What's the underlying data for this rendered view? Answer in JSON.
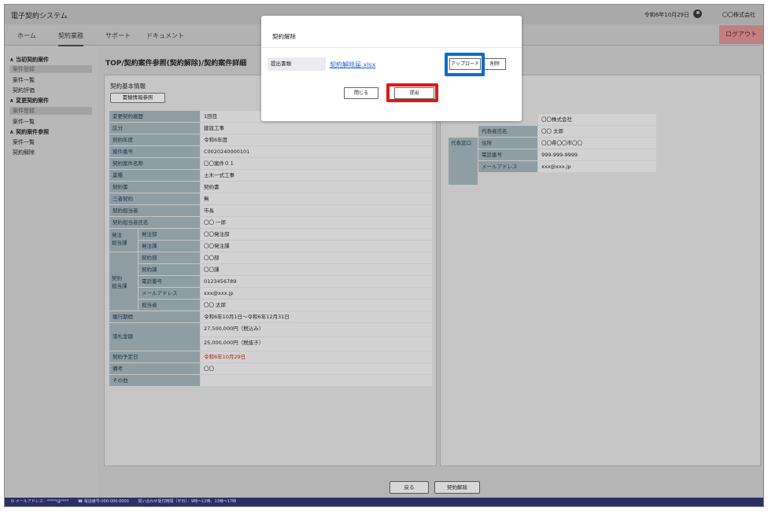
{
  "header": {
    "app_title": "電子契約システム",
    "datetime": "令和6年10月29日",
    "user_name": "〇〇株式会社"
  },
  "nav": {
    "tabs": [
      "ホーム",
      "契約業務",
      "サポート",
      "ドキュメント"
    ],
    "logout": "ログアウト"
  },
  "sidebar": {
    "items": [
      {
        "label": "∧ 当初契約案件",
        "type": "head"
      },
      {
        "label": "案件登録",
        "type": "active"
      },
      {
        "label": "案件一覧",
        "type": "item"
      },
      {
        "label": "契約評価",
        "type": "item"
      },
      {
        "label": "∧ 変更契約案件",
        "type": "head"
      },
      {
        "label": "案件登録",
        "type": "active"
      },
      {
        "label": "案件一覧",
        "type": "item"
      },
      {
        "label": "∧ 契約案件参照",
        "type": "head"
      },
      {
        "label": "案件一覧",
        "type": "item"
      },
      {
        "label": "契約解除",
        "type": "item"
      }
    ]
  },
  "main": {
    "breadcrumb": "TOP/契約案件参照(契約解除)/契約案件詳細",
    "section_title": "契約基本情報",
    "ref_button": "書類情報参照",
    "rows": [
      {
        "label": "変更契約履歴",
        "value": "1回目"
      },
      {
        "label": "区分",
        "value": "建設工事"
      },
      {
        "label": "契約年度",
        "value": "令和6年度"
      },
      {
        "label": "案件番号",
        "value": "C00202400001​01"
      },
      {
        "label": "契約案件名称",
        "value": "〇〇案件０１"
      },
      {
        "label": "業種",
        "value": "土木一式工事"
      },
      {
        "label": "契約書",
        "value": "契約書"
      },
      {
        "label": "三者契約",
        "value": "無"
      },
      {
        "label": "契約担当者",
        "value": "市長"
      },
      {
        "label": "契約担当者氏名",
        "value": "〇〇 一郎"
      }
    ],
    "hatchu_group": "発注\n担当課",
    "hatchu_rows": [
      {
        "label": "発注部",
        "value": "〇〇発注部"
      },
      {
        "label": "発注課",
        "value": "〇〇発注課"
      }
    ],
    "keiyaku_group": "契約\n担当課",
    "keiyaku_rows": [
      {
        "label": "契約部",
        "value": "〇〇部"
      },
      {
        "label": "契約課",
        "value": "〇〇課"
      },
      {
        "label": "電話番号",
        "value": "0123456789"
      },
      {
        "label": "メールアドレス",
        "value": "xxx@xxx.jp"
      },
      {
        "label": "担当者",
        "value": "〇〇 太郎"
      }
    ],
    "period_label": "履行期間",
    "period_value": "令和6年10月1日～令和6年12月31日",
    "amount_label": "落札金額",
    "amount_value_1": "27,500,000円（税込み）",
    "amount_value_2": "25,000,000円（税抜き）",
    "planned_label": "契約予定日",
    "planned_value": "令和6年10月29日",
    "note_label": "備考",
    "note_value": "〇〇",
    "other_label": "その他",
    "other_value": ""
  },
  "right": {
    "company_value": "〇〇株式会社",
    "rep_label": "代表者氏名",
    "rep_value": "〇〇 太郎",
    "group": "代表窓口",
    "addr_label": "住所",
    "addr_value": "〇〇県〇〇市〇〇",
    "tel_label": "電話番号",
    "tel_value": "999-999-9999",
    "mail_label": "メールアドレス",
    "mail_value": "xxx@xxx.jp"
  },
  "bottom": {
    "back": "戻る",
    "cancel": "契約解除"
  },
  "footer": {
    "items": [
      "✉ メールアドレス：*****@****",
      "☎ 電話番号:000-000-0000",
      "問い合わせ受付時間（平日）：9時～12時、13時～17時"
    ]
  },
  "modal": {
    "title": "契約解除",
    "field_label": "提出書類",
    "file_name": "契約解除届.xlsx",
    "upload": "アップロード",
    "delete": "削除",
    "close": "閉じる",
    "submit": "提出"
  },
  "colors": {
    "highlight_blue": "#0a6ccc",
    "highlight_red": "#e01818",
    "link": "#2a5fd6",
    "footer_bg": "#2c2f63"
  }
}
